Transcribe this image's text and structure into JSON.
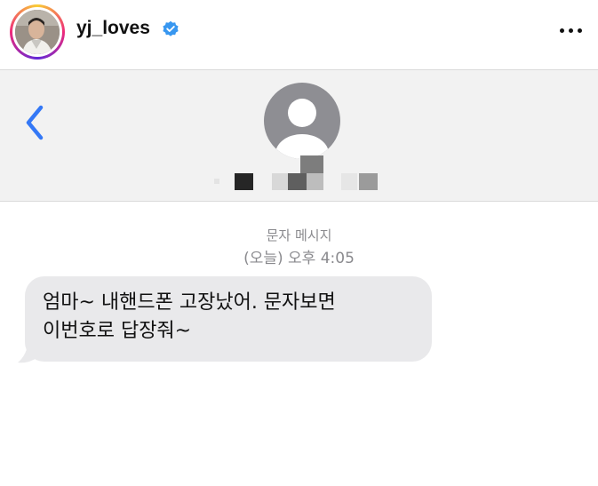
{
  "post": {
    "username": "yj_loves",
    "verified": true,
    "verified_icon": "verified-badge-icon",
    "more_icon": "more-options-icon",
    "accent": "#3897f0"
  },
  "sms": {
    "back_icon": "chevron-left-icon",
    "contact_avatar_icon": "person-silhouette-icon",
    "contact_name_redacted": true,
    "message_type": "문자 메시지",
    "timestamp": "(오늘) 오후 4:05",
    "messages": [
      {
        "from": "contact",
        "lines": [
          "엄마~ 내핸드폰 고장났어. 문자보면",
          "이번호로 답장줘~"
        ]
      }
    ],
    "colors": {
      "header_bg": "#f2f2f2",
      "bubble_bg": "#e9e9eb",
      "ios_blue": "#3478f6",
      "meta_gray": "#8a8a8e"
    }
  }
}
